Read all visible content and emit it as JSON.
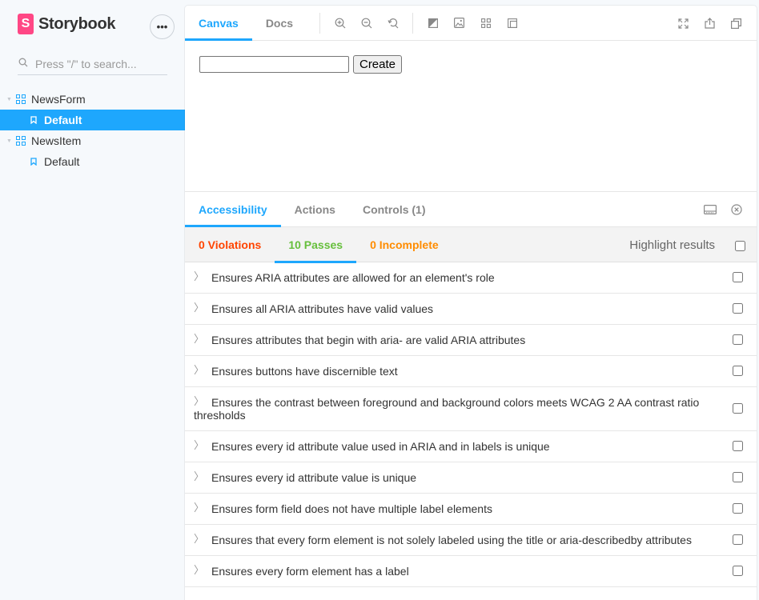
{
  "sidebar": {
    "logo_mark": "S",
    "logo_text": "Storybook",
    "menu_label": "•••",
    "search_placeholder": "Press \"/\" to search...",
    "tree": [
      {
        "type": "component",
        "label": "NewsForm"
      },
      {
        "type": "story",
        "label": "Default",
        "selected": true
      },
      {
        "type": "component",
        "label": "NewsItem"
      },
      {
        "type": "story",
        "label": "Default",
        "selected": false
      }
    ]
  },
  "toolbar": {
    "tabs": [
      {
        "label": "Canvas",
        "active": true
      },
      {
        "label": "Docs",
        "active": false
      }
    ],
    "tools": [
      "zoom-in-icon",
      "zoom-out-icon",
      "zoom-reset-icon",
      "background-icon",
      "image-icon",
      "grid-icon",
      "outline-icon"
    ],
    "right_tools": [
      "fullscreen-icon",
      "share-icon",
      "copy-icon"
    ]
  },
  "canvas": {
    "input_value": "",
    "create_label": "Create"
  },
  "addons": {
    "tabs": [
      {
        "label": "Accessibility",
        "active": true
      },
      {
        "label": "Actions",
        "active": false
      },
      {
        "label": "Controls (1)",
        "active": false
      }
    ]
  },
  "a11y": {
    "tabs": [
      {
        "label": "0 Violations",
        "color": "#ff4400"
      },
      {
        "label": "10 Passes",
        "color": "#66bf3c",
        "active": true
      },
      {
        "label": "0 Incomplete",
        "color": "#ff8c00"
      }
    ],
    "highlight_label": "Highlight results",
    "rules": [
      "Ensures ARIA attributes are allowed for an element's role",
      "Ensures all ARIA attributes have valid values",
      "Ensures attributes that begin with aria- are valid ARIA attributes",
      "Ensures buttons have discernible text",
      "Ensures the contrast between foreground and background colors meets WCAG 2 AA contrast ratio thresholds",
      "Ensures every id attribute value used in ARIA and in labels is unique",
      "Ensures every id attribute value is unique",
      "Ensures form field does not have multiple label elements",
      "Ensures that every form element is not solely labeled using the title or aria-describedby attributes",
      "Ensures every form element has a label"
    ]
  },
  "colors": {
    "accent": "#1ea7fd",
    "brand": "#ff4785"
  }
}
